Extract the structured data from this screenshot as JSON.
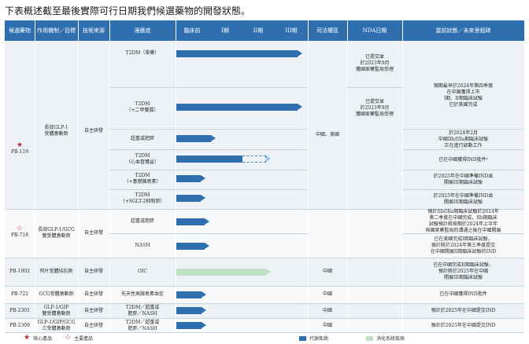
{
  "intro": "下表概述截至最後實際可行日期我們候選藥物的開發狀態。",
  "colors": {
    "header": "#2f6fb0",
    "bar_metabolic": "#2f6fb0",
    "bar_gi": "#bfe0c3",
    "star": "#c0262d"
  },
  "headers": [
    "候選藥物",
    "作用機制／目標",
    "技術來源",
    "適應症",
    "臨床前",
    "I期",
    "II期",
    "III期",
    "司法權區",
    "NDA日期",
    "當前狀態／未來里程碑"
  ],
  "groups": {
    "pb119": {
      "drug": "PB-119",
      "mechanism": "長效GLP-1\n受體激動劑",
      "source": "自主研發",
      "region": "中國、美國"
    },
    "pb718": {
      "drug": "PB-718",
      "mechanism": "長效GLP-1/GCG\n雙受體激動劑",
      "source": "自主研發"
    },
    "pb718_region": "中國、美國",
    "pb1902": {
      "drug": "PB-1902",
      "mechanism": "阿片受體拮抗劑",
      "source": "自主研發",
      "region": "中國",
      "indication": "OIC",
      "status": "已在中國完成II期臨床試驗，\n預計將於2025年在中國\n開展III期臨床試驗"
    },
    "pb722": {
      "drug": "PB-722",
      "mechanism": "GCG受體激動劑",
      "source": "自主研發",
      "region": "中國",
      "indication": "先天性高胰島素血症",
      "status": "已在中國獲得IND批件"
    },
    "pb2301": {
      "drug": "PB-2301",
      "mechanism": "GLP-1/GIP\n雙受體激動劑",
      "source": "自主研發",
      "region": "中國",
      "indication": "T2DM／超重或\n肥胖／NASH",
      "status": "預計於2025年在中國提交IND"
    },
    "pb2309": {
      "drug": "PB-2309",
      "mechanism": "GLP-1/GIP/GCG\n三受體激動劑",
      "source": "自主研發",
      "region": "中國",
      "indication": "T2DM／超重或\n肥胖／NASH",
      "status": "預計於2025年在中國提交IND"
    }
  },
  "pb119_rows": [
    {
      "indication": "T2DM（單藥）",
      "nda": "已提交並\n於2023年9月\n獲國家藥監局受理",
      "progress": 0.96
    },
    {
      "indication": "T2DM\n（+二甲雙胍）",
      "nda": "已提交並\n於2023年9月\n獲國家藥監局受理",
      "progress": 0.96
    },
    {
      "indication": "超重或肥胖",
      "nda": "",
      "progress": 0.3
    },
    {
      "indication": "T2DM\n（心血管獲益）",
      "nda": "",
      "progress": 0.72
    },
    {
      "indication": "T2DM\n（+基礎胰島素）",
      "nda": "",
      "progress": 0.22
    },
    {
      "indication": "T2DM\n（+SGLT-2抑制劑）",
      "nda": "",
      "progress": 0.22
    }
  ],
  "pb119_status": {
    "s1": "預期最早於2024年第四季度\n在中國獲得上市\nI期、II期臨床試驗\n已於美國完成",
    "s2": "於2024年2月\n中國IIb/IIIa期臨床試驗\n正在進行啟動工作",
    "s3": "已在中國獲得IND批件²",
    "s4": "於2025年在中國準備IND並\n開展III期臨床試驗",
    "s5": "於2025年在中國準備IND並\n開展III期臨床試驗"
  },
  "pb718_rows": [
    {
      "indication": "超重或肥胖",
      "progress": 0.25,
      "status": "預計IIb/IIIa期臨床試驗於2024年\n第二季度在中國完成，IIb期臨床\n試驗預計將按期於2024年上半年\n與國家藥監局的溝通之後在中國開展"
    },
    {
      "indication": "NASH",
      "progress": 0.25,
      "status": "已在美國完成I期臨床試驗，\n預計將於2024年第三季度提交\n在中國開展II期臨床試驗的IND"
    }
  ],
  "legend": {
    "core": "核心產品",
    "key": "主要產品",
    "metabolic": "代謝疾病",
    "gi": "消化系統疾病"
  }
}
